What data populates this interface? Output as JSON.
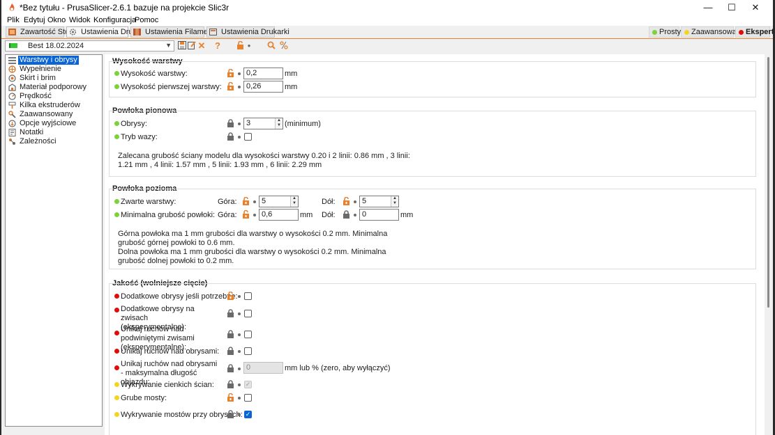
{
  "window": {
    "title": "*Bez tytułu - PrusaSlicer-2.6.1 bazuje na projekcie Slic3r",
    "minimize": "—",
    "maximize": "☐",
    "close": "✕"
  },
  "menu": [
    "Plik",
    "Edytuj",
    "Okno",
    "Widok",
    "Konfiguracja",
    "Pomoc"
  ],
  "tabs": [
    {
      "label": "Zawartość Stołu",
      "icon": "plater-icon"
    },
    {
      "label": "Ustawienia Druku",
      "icon": "gear-icon",
      "active": true
    },
    {
      "label": "Ustawienia Filamentu",
      "icon": "filament-icon"
    },
    {
      "label": "Ustawienia Drukarki",
      "icon": "printer-icon"
    }
  ],
  "modes": [
    {
      "label": "Prosty",
      "color": "#7dd13a"
    },
    {
      "label": "Zaawansowane",
      "color": "#f5d320"
    },
    {
      "label": "Ekspert",
      "color": "#e20b0b",
      "active": true
    }
  ],
  "preset": {
    "value": "Best 18.02.2024"
  },
  "tree": [
    "Warstwy i obrysy",
    "Wypełnienie",
    "Skirt i brim",
    "Materiał podporowy",
    "Prędkość",
    "Kilka ekstruderów",
    "Zaawansowany",
    "Opcje wyjściowe",
    "Notatki",
    "Zależności"
  ],
  "colors": {
    "accent": "#e8812c",
    "selection": "#0a64d6",
    "simple": "#7dd13a",
    "advanced": "#f5d320",
    "expert": "#e20b0b"
  },
  "sections": {
    "layer_height": {
      "title": "Wysokość warstwy",
      "layer_height_label": "Wysokość warstwy:",
      "layer_height_value": "0,2",
      "first_layer_label": "Wysokość pierwszej warstwy:",
      "first_layer_value": "0,26",
      "unit": "mm"
    },
    "vertical_shells": {
      "title": "Powłoka pionowa",
      "perimeters_label": "Obrysy:",
      "perimeters_value": "3",
      "perimeters_unit": "(minimum)",
      "spiral_label": "Tryb wazy:",
      "info": "Zalecana grubość ściany modelu dla wysokości warstwy 0.20 i 2 linii: 0.86 mm , 3 linii: 1.21 mm , 4 linii: 1.57 mm , 5 linii: 1.93 mm , 6 linii: 2.29 mm"
    },
    "horizontal_shells": {
      "title": "Powłoka pozioma",
      "solid_layers_label": "Zwarte warstwy:",
      "top_label": "Góra:",
      "top_value": "5",
      "bottom_label": "Dół:",
      "bottom_value": "5",
      "min_thickness_label": "Minimalna grubość powłoki:",
      "min_top_value": "0,6",
      "min_bottom_value": "0",
      "unit": "mm",
      "info": "Górna powłoka ma 1 mm grubości dla warstwy o wysokości 0.2 mm. Minimalna grubość górnej powłoki to 0.6 mm.\nDolna powłoka ma 1 mm grubości dla warstwy o wysokości 0.2 mm. Minimalna grubość dolnej powłoki to 0.2 mm."
    },
    "quality": {
      "title": "Jakość (wolniejsze cięcie)",
      "rows": [
        {
          "label": "Dodatkowe obrysy jeśli potrzebne:",
          "dot": "#e20b0b",
          "lock": "open",
          "checked": false
        },
        {
          "label": "Dodatkowe obrysy na zwisach (eksperymentalne):",
          "dot": "#e20b0b",
          "lock": "closed",
          "checked": false
        },
        {
          "label": "Unikaj ruchów nad podwiniętymi zwisami (eksperymentalne):",
          "dot": "#e20b0b",
          "lock": "closed",
          "checked": false
        },
        {
          "label": "Unikaj ruchów nad obrysami:",
          "dot": "#e20b0b",
          "lock": "closed",
          "checked": false
        },
        {
          "label": "Unikaj ruchów nad obrysami - maksymalna długość objazdu:",
          "dot": "#e20b0b",
          "lock": "closed",
          "value": "0",
          "unit": "mm lub % (zero, aby wyłączyć)"
        },
        {
          "label": "Wykrywanie cienkich ścian:",
          "dot": "#f5d320",
          "lock": "closed",
          "checked": "disabled"
        },
        {
          "label": "Grube mosty:",
          "dot": "#f5d320",
          "lock": "open",
          "checked": false
        },
        {
          "label": "Wykrywanie mostów przy obrysach:",
          "dot": "#f5d320",
          "lock": "closed",
          "checked": true
        }
      ]
    }
  }
}
